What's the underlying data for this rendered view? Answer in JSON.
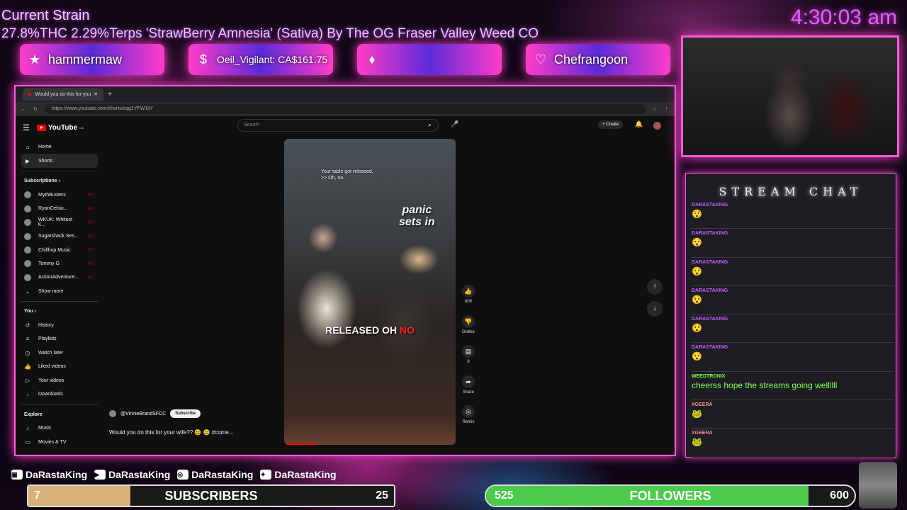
{
  "overlay": {
    "strain_title": "Current Strain",
    "strain_text": "27.8%THC 2.29%Terps 'StrawBerry Amnesia' (Sativa) By The OG Fraser Valley Weed CO",
    "clock": "4:30:03 am",
    "alerts": [
      {
        "icon": "star-icon",
        "glyph": "★",
        "text": "hammermaw"
      },
      {
        "icon": "dollar-icon",
        "glyph": "$",
        "text": "Oeil_Vigilant: CA$161.75"
      },
      {
        "icon": "diamond-icon",
        "glyph": "♦",
        "text": ""
      },
      {
        "icon": "heart-icon",
        "glyph": "♡",
        "text": "Chefrangoon"
      }
    ],
    "socials": [
      {
        "icon": "twitch-icon",
        "glyph": "▣",
        "handle": "DaRastaKing"
      },
      {
        "icon": "youtube-icon",
        "glyph": "▶",
        "handle": "DaRastaKing"
      },
      {
        "icon": "instagram-icon",
        "glyph": "◎",
        "handle": "DaRastaKing"
      },
      {
        "icon": "twitter-icon",
        "glyph": "✦",
        "handle": "DaRastaKing"
      }
    ],
    "subscribers": {
      "current": "7",
      "label": "SUBSCRIBERS",
      "goal": "25",
      "progress": 0.28
    },
    "followers": {
      "current": "525",
      "label": "FOLLOWERS",
      "goal": "600",
      "progress": 0.875
    }
  },
  "browser": {
    "tab_title": "Would you do this for you",
    "url": "https://www.youtube.com/shorts/cqg1YFW1ljY"
  },
  "youtube": {
    "logo": "YouTube",
    "logo_sup": "CA",
    "search_placeholder": "Search",
    "create_label": "Create",
    "nav": [
      {
        "icon": "home-icon",
        "glyph": "⌂",
        "label": "Home"
      },
      {
        "icon": "shorts-icon",
        "glyph": "▶",
        "label": "Shorts"
      }
    ],
    "subscriptions_label": "Subscriptions",
    "subscriptions": [
      "MythBusters",
      "RyanCelsiu...",
      "WKUK: Whitest K...",
      "Sugarshack Ses...",
      "Chillhop Music",
      "Tommy G",
      "ActionAdventure..."
    ],
    "show_more": "Show more",
    "you_label": "You",
    "you_items": [
      {
        "icon": "history-icon",
        "glyph": "↺",
        "label": "History"
      },
      {
        "icon": "playlist-icon",
        "glyph": "≡",
        "label": "Playlists"
      },
      {
        "icon": "clock-icon",
        "glyph": "◷",
        "label": "Watch later"
      },
      {
        "icon": "like-icon",
        "glyph": "👍",
        "label": "Liked videos"
      },
      {
        "icon": "video-icon",
        "glyph": "▷",
        "label": "Your videos"
      },
      {
        "icon": "download-icon",
        "glyph": "↓",
        "label": "Downloads"
      }
    ],
    "explore_label": "Explore",
    "explore_items": [
      {
        "icon": "music-icon",
        "glyph": "♪",
        "label": "Music"
      },
      {
        "icon": "film-icon",
        "glyph": "▭",
        "label": "Movies & TV"
      }
    ],
    "video": {
      "caption_line1": "Your table got released.",
      "caption_line2": ">> Oh, no.",
      "caption_panic_1": "panic",
      "caption_panic_2": "sets in",
      "caption_bottom": "RELEASED OH ",
      "caption_bottom_red": "NO"
    },
    "actions": [
      {
        "icon": "thumbs-up-icon",
        "glyph": "👍",
        "label": "805"
      },
      {
        "icon": "thumbs-down-icon",
        "glyph": "👎",
        "label": "Dislike"
      },
      {
        "icon": "comment-icon",
        "glyph": "▤",
        "label": "8"
      },
      {
        "icon": "share-icon",
        "glyph": "➦",
        "label": "Share"
      },
      {
        "icon": "remix-icon",
        "glyph": "◎",
        "label": "Remix"
      }
    ],
    "channel": "@VinnieBrandSFCC",
    "subscribe": "Subscribe",
    "title": "Would you do this for your wife?? 😆 😆 #come..."
  },
  "chat": {
    "title": "STREAM CHAT",
    "messages": [
      {
        "user": "DARASTAKING",
        "body": "😯",
        "cls": ""
      },
      {
        "user": "DARASTAKING",
        "body": "😯",
        "cls": ""
      },
      {
        "user": "DARASTAKING",
        "body": "😯",
        "cls": ""
      },
      {
        "user": "DARASTAKING",
        "body": "😯",
        "cls": ""
      },
      {
        "user": "DARASTAKING",
        "body": "😯",
        "cls": ""
      },
      {
        "user": "DARASTAKING",
        "body": "😯",
        "cls": ""
      },
      {
        "user": "WEEDTRONIX",
        "body": "cheerss hope the streams going wellllll",
        "cls": "g"
      },
      {
        "user": "XGEERA",
        "body": "🐸",
        "cls": "b"
      },
      {
        "user": "XGEERA",
        "body": "🐸",
        "cls": "b"
      }
    ]
  }
}
